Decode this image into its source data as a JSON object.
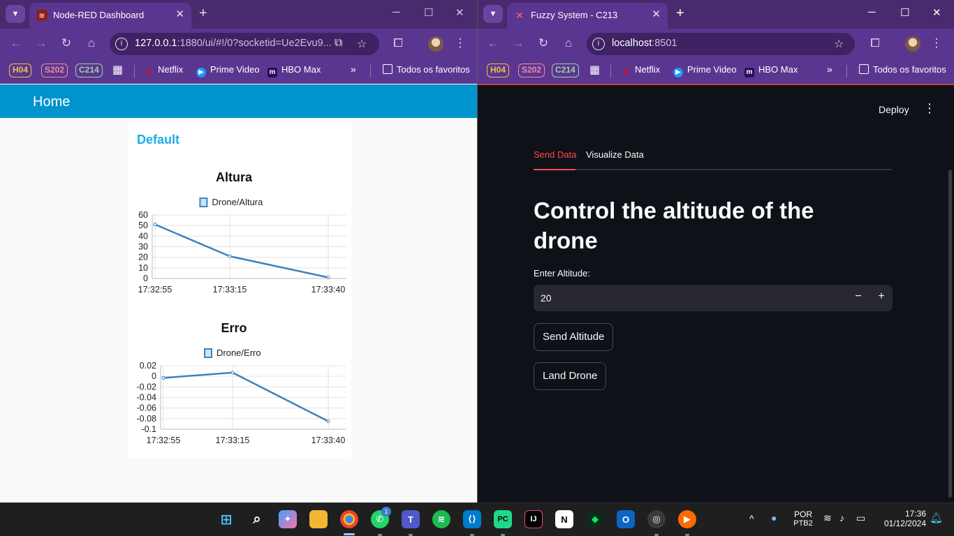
{
  "left_window": {
    "tab_title": "Node-RED Dashboard",
    "url_host": "127.0.0.1",
    "url_rest": ":1880/ui/#!/0?socketid=Ue2Evu9...",
    "dashboard": {
      "header_title": "Home",
      "group_title": "Default"
    }
  },
  "right_window": {
    "tab_title": "Fuzzy System - C213",
    "url_host": "localhost",
    "url_rest": ":8501",
    "streamlit": {
      "deploy_label": "Deploy",
      "tabs": [
        "Send Data",
        "Visualize Data"
      ],
      "active_tab": "Send Data",
      "title": "Control the altitude of the drone",
      "input_label": "Enter Altitude:",
      "input_value": "20",
      "minus_label": "−",
      "plus_label": "+",
      "send_button": "Send Altitude",
      "land_button": "Land Drone"
    }
  },
  "bookmarks": {
    "badges": [
      {
        "label": "H04",
        "color": "#f0c040"
      },
      {
        "label": "S202",
        "color": "#f08a9c"
      },
      {
        "label": "C214",
        "color": "#9bd4a4"
      }
    ],
    "items": [
      "Netflix",
      "Prime Video",
      "HBO Max"
    ],
    "folder": "Todos os favoritos"
  },
  "chart_data": [
    {
      "type": "line",
      "title": "Altura",
      "series": [
        {
          "name": "Drone/Altura",
          "x": [
            "17:32:55",
            "17:33:15",
            "17:33:40"
          ],
          "values": [
            51,
            21,
            1
          ]
        }
      ],
      "x_ticks": [
        "17:32:55",
        "17:33:15",
        "17:33:40"
      ],
      "y_ticks": [
        "60",
        "50",
        "40",
        "30",
        "20",
        "10",
        "0"
      ],
      "ylim": [
        0,
        60
      ],
      "grid": true,
      "legend_placement": "top-center",
      "color": "#3a83c2"
    },
    {
      "type": "line",
      "title": "Erro",
      "series": [
        {
          "name": "Drone/Erro",
          "x": [
            "17:32:55",
            "17:33:15",
            "17:33:40"
          ],
          "values": [
            -0.003,
            0.007,
            -0.085
          ]
        }
      ],
      "x_ticks": [
        "17:32:55",
        "17:33:15",
        "17:33:40"
      ],
      "y_ticks": [
        "0.02",
        "0",
        "-0.02",
        "-0.04",
        "-0.06",
        "-0.08",
        "-0.1"
      ],
      "ylim": [
        -0.1,
        0.02
      ],
      "grid": true,
      "legend_placement": "top-center",
      "color": "#3a83c2"
    }
  ],
  "taskbar": {
    "lang_top": "POR",
    "lang_bottom": "PTB2",
    "time": "17:36",
    "date": "01/12/2024",
    "whatsapp_badge": "1"
  },
  "colors": {
    "chrome_purple": "#5b3690",
    "nodered_blue": "#0094ce",
    "streamlit_red": "#ff4b4b",
    "streamlit_bg": "#0e1117"
  }
}
